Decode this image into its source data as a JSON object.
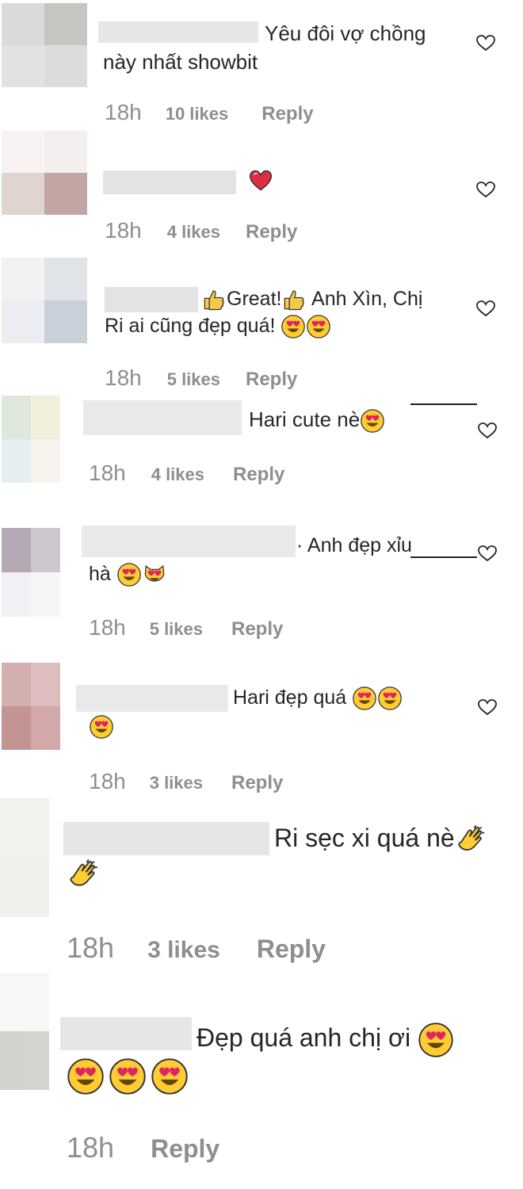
{
  "comments": [
    {
      "text_before": "Yêu đôi vợ chồng",
      "text_line2": "này nhất showbit",
      "time": "18h",
      "likes": "10 likes",
      "reply": "Reply"
    },
    {
      "text_before": "",
      "time": "18h",
      "likes": "4 likes",
      "reply": "Reply",
      "emoji_names": [
        "red-heart"
      ]
    },
    {
      "text_before": "Great!",
      "text_mid": " Anh Xìn, Chị",
      "text_line2": "Ri ai cũng đẹp quá! ",
      "time": "18h",
      "likes": "5 likes",
      "reply": "Reply",
      "emoji_names": [
        "thumbs-up",
        "thumbs-up",
        "heart-eyes",
        "heart-eyes"
      ]
    },
    {
      "text_before": "Hari cute nè",
      "time": "18h",
      "likes": "4 likes",
      "reply": "Reply",
      "emoji_names": [
        "heart-eyes"
      ]
    },
    {
      "text_before": "· Anh đẹp xỉu",
      "text_line2": "hà ",
      "time": "18h",
      "likes": "5 likes",
      "reply": "Reply",
      "emoji_names": [
        "heart-eyes",
        "heart-eyes-cat"
      ]
    },
    {
      "text_before": "Hari đẹp quá ",
      "time": "18h",
      "likes": "3 likes",
      "reply": "Reply",
      "emoji_names": [
        "heart-eyes",
        "heart-eyes",
        "heart-eyes"
      ]
    },
    {
      "text_before": "Ri sẹc xi quá nè",
      "time": "18h",
      "likes": "3 likes",
      "reply": "Reply",
      "emoji_names": [
        "clapping-hands",
        "clapping-hands"
      ]
    },
    {
      "text_before": "Đẹp quá anh chị ơi ",
      "time": "18h",
      "reply": "Reply",
      "emoji_names": [
        "heart-eyes",
        "heart-eyes",
        "heart-eyes",
        "heart-eyes"
      ]
    }
  ],
  "icons": {
    "like": "heart-outline-icon"
  },
  "colors": {
    "text": "#262626",
    "meta": "#8e8e8e",
    "placeholder": "#e3e3e3",
    "emoji_face": "#ffcc33",
    "heart_red": "#dd2e44"
  }
}
